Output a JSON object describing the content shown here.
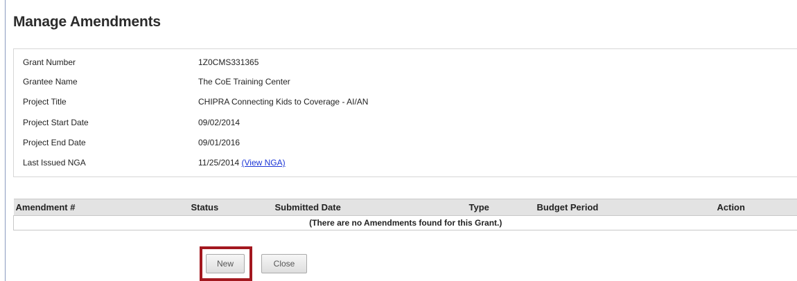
{
  "page": {
    "title": "Manage Amendments"
  },
  "grant_info": [
    {
      "label": "Grant Number",
      "value": "1Z0CMS331365"
    },
    {
      "label": "Grantee Name",
      "value": "The CoE Training Center"
    },
    {
      "label": "Project Title",
      "value": "CHIPRA Connecting Kids to Coverage - AI/AN"
    },
    {
      "label": "Project Start Date",
      "value": "09/02/2014"
    },
    {
      "label": "Project End Date",
      "value": "09/01/2016"
    },
    {
      "label": "Last Issued NGA",
      "value": "11/25/2014",
      "link": "(View NGA)"
    }
  ],
  "amendments_table": {
    "columns": [
      "Amendment #",
      "Status",
      "Submitted Date",
      "Type",
      "Budget Period",
      "Action"
    ],
    "empty_message": "(There are no Amendments found for this Grant.)"
  },
  "buttons": {
    "new_label": "New",
    "close_label": "Close"
  },
  "colors": {
    "highlight": "#a3181f",
    "link": "#1a34d6",
    "header_bg": "#e3e3e3"
  }
}
